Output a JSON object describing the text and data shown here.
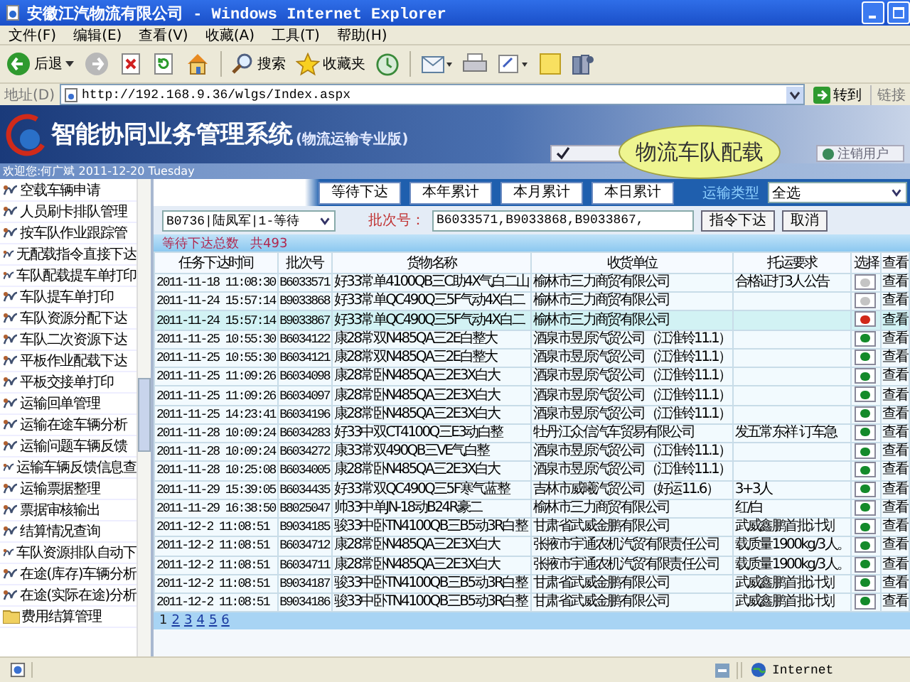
{
  "window": {
    "title": "安徽江汽物流有限公司 - Windows Internet Explorer"
  },
  "menu": [
    "文件(F)",
    "编辑(E)",
    "查看(V)",
    "收藏(A)",
    "工具(T)",
    "帮助(H)"
  ],
  "toolbar": {
    "back": "后退",
    "search": "搜索",
    "favorites": "收藏夹"
  },
  "address": {
    "label": "地址(D)",
    "url": "http://192.168.9.36/wlgs/Index.aspx",
    "go": "转到",
    "links": "链接"
  },
  "banner": {
    "title": "智能协同业务管理系统",
    "subtitle": "(物流运输专业版)",
    "button": "注销用户"
  },
  "callout": "物流车队配载",
  "welcome": "欢迎您:何广斌 2011-12-20 Tuesday",
  "sidebar": {
    "items": [
      "空载车辆申请",
      "人员刷卡排队管理",
      "按车队作业跟踪管",
      "无配载指令直接下达",
      "车队配载提车单打印",
      "车队提车单打印",
      "车队资源分配下达",
      "车队二次资源下达",
      "平板作业配载下达",
      "平板交接单打印",
      "运输回单管理",
      "运输在途车辆分析",
      "运输问题车辆反馈",
      "运输车辆反馈信息查",
      "运输票据整理",
      "票据审核输出",
      "结算情况查询",
      "车队资源排队自动下",
      "在途(库存)车辆分析",
      "在途(实际在途)分析"
    ],
    "folder": "费用结算管理"
  },
  "filters": {
    "buttons": [
      "等待下达",
      "本年累计",
      "本月累计",
      "本日累计"
    ],
    "type_label": "运输类型",
    "type_value": "全选"
  },
  "dispatcher": "B0736|陆凤军|1-等待",
  "batch": {
    "label": "批次号：",
    "value": "B6033571,B9033868,B9033867,"
  },
  "actions": [
    "指令下达",
    "取消"
  ],
  "summary": {
    "label": "等待下达总数",
    "count": "共493"
  },
  "table": {
    "columns": [
      "任务下达时间",
      "批次号",
      "货物名称",
      "收货单位",
      "托运要求",
      "选择",
      "查看"
    ],
    "rows": [
      {
        "time": "2011-11-18 11:08:30",
        "batch": "B6033571",
        "goods": "好33常单4100QB三C助4X气白二山",
        "consignee": "榆林市三力商贸有限公司",
        "requirement": "合格证打3人公告",
        "color": "#c4c4c4",
        "view": "查看",
        "selected": false
      },
      {
        "time": "2011-11-24 15:57:14",
        "batch": "B9033868",
        "goods": "好33常单QC490Q三5F气动4X白二",
        "consignee": "榆林市三力商贸有限公司",
        "color": "#c4c4c4",
        "view": "查看",
        "selected": false
      },
      {
        "time": "2011-11-24 15:57:14",
        "batch": "B9033867",
        "goods": "好33常单QC490Q三5F气动4X白二",
        "consignee": "榆林市三力商贸有限公司",
        "color": "#d02818",
        "view": "查看",
        "selected": true
      },
      {
        "time": "2011-11-25 10:55:30",
        "batch": "B6034122",
        "goods": "康28常双N485QA三2E白整大",
        "consignee": "酒泉市昱原汽贸公司（江淮铃11.1）",
        "color": "#148a2a",
        "view": "查看",
        "selected": false
      },
      {
        "time": "2011-11-25 10:55:30",
        "batch": "B6034121",
        "goods": "康28常双N485QA三2E白整大",
        "consignee": "酒泉市昱原汽贸公司（江淮铃11.1）",
        "color": "#148a2a",
        "view": "查看",
        "selected": false
      },
      {
        "time": "2011-11-25 11:09:26",
        "batch": "B6034098",
        "goods": "康28常卧N485QA三2E3X白大",
        "consignee": "酒泉市昱原汽贸公司（江淮铃11.1）",
        "color": "#148a2a",
        "view": "查看",
        "selected": false
      },
      {
        "time": "2011-11-25 11:09:26",
        "batch": "B6034097",
        "goods": "康28常卧N485QA三2E3X白大",
        "consignee": "酒泉市昱原汽贸公司（江淮铃11.1）",
        "color": "#148a2a",
        "view": "查看",
        "selected": false
      },
      {
        "time": "2011-11-25 14:23:41",
        "batch": "B6034196",
        "goods": "康28常卧N485QA三2E3X白大",
        "consignee": "酒泉市昱原汽贸公司（江淮铃11.1）",
        "color": "#148a2a",
        "view": "查看",
        "selected": false
      },
      {
        "time": "2011-11-28 10:09:24",
        "batch": "B6034283",
        "goods": "好33中双CT4100Q三E3动白整",
        "consignee": "牡丹江众信汽车贸易有限公司",
        "requirement": "发五常东祥 订车急",
        "color": "#148a2a",
        "view": "查看",
        "selected": false
      },
      {
        "time": "2011-11-28 10:09:24",
        "batch": "B6034272",
        "goods": "康33常双490QB三VE气白整",
        "consignee": "酒泉市昱原汽贸公司（江淮铃11.1）",
        "color": "#148a2a",
        "view": "查看",
        "selected": false
      },
      {
        "time": "2011-11-28 10:25:08",
        "batch": "B6034005",
        "goods": "康28常卧N485QA三2E3X白大",
        "consignee": "酒泉市昱原汽贸公司（江淮铃11.1）",
        "color": "#148a2a",
        "view": "查看",
        "selected": false
      },
      {
        "time": "2011-11-29 15:39:05",
        "batch": "B6034435",
        "goods": "好33常双QC490Q三5F寒气蓝整",
        "consignee": "吉林市威曦汽贸公司（好运11.6）",
        "requirement": "3+3人",
        "color": "#148a2a",
        "view": "查看",
        "selected": false
      },
      {
        "time": "2011-11-29 16:38:50",
        "batch": "B8025047",
        "goods": "帅33中单JN-18动B24R豪二",
        "consignee": "榆林市三力商贸有限公司",
        "requirement": "红/白",
        "color": "#148a2a",
        "view": "查看",
        "selected": false
      },
      {
        "time": "2011-12-2 11:08:51",
        "batch": "B9034185",
        "goods": "骏33中卧TN4100QB三B5动3R白整",
        "consignee": "甘肃省武威金鹏有限公司",
        "requirement": "武威鑫鹏首批计划",
        "color": "#148a2a",
        "view": "查看",
        "selected": false
      },
      {
        "time": "2011-12-2 11:08:51",
        "batch": "B6034712",
        "goods": "康28常卧N485QA三2E3X白大",
        "consignee": "张掖市宇通农机汽贸有限责任公司",
        "requirement": "载质量1900kg/3人。",
        "color": "#148a2a",
        "view": "查看",
        "selected": false
      },
      {
        "time": "2011-12-2 11:08:51",
        "batch": "B6034711",
        "goods": "康28常卧N485QA三2E3X白大",
        "consignee": "张掖市宇通农机汽贸有限责任公司",
        "requirement": "载质量1900kg/3人。",
        "color": "#148a2a",
        "view": "查看",
        "selected": false
      },
      {
        "time": "2011-12-2 11:08:51",
        "batch": "B9034187",
        "goods": "骏33中卧TN4100QB三B5动3R白整",
        "consignee": "甘肃省武威金鹏有限公司",
        "requirement": "武威鑫鹏首批计划",
        "color": "#148a2a",
        "view": "查看",
        "selected": false
      },
      {
        "time": "2011-12-2 11:08:51",
        "batch": "B9034186",
        "goods": "骏33中卧TN4100QB三B5动3R白整",
        "consignee": "甘肃省武威金鹏有限公司",
        "requirement": "武威鑫鹏首批计划",
        "color": "#148a2a",
        "view": "查看",
        "selected": false
      }
    ]
  },
  "pages": [
    {
      "label": "1",
      "selected": true
    },
    {
      "label": "2",
      "selected": false
    },
    {
      "label": "3",
      "selected": false
    },
    {
      "label": "4",
      "selected": false
    },
    {
      "label": "5",
      "selected": false
    },
    {
      "label": "6",
      "selected": false
    }
  ],
  "status_bar": {
    "zone": "Internet"
  }
}
